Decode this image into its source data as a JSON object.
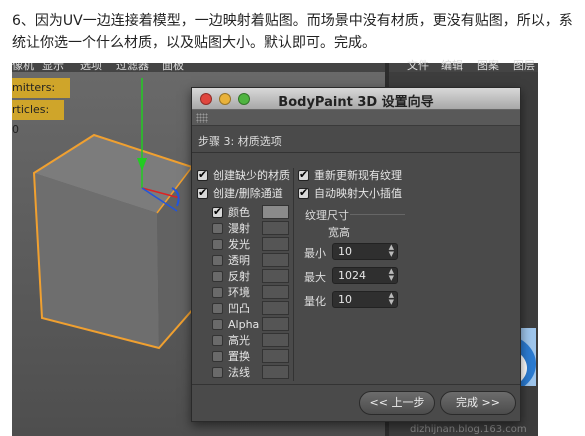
{
  "article": {
    "line1": "6、因为UV一边连接着模型，一边映射着贴图。而场景中没有材质，更没有贴图，所以，系",
    "line2": "统让你选一个什么材质，以及贴图大小。默认即可。完成。"
  },
  "viewport": {
    "menu": [
      "像机",
      "显示",
      "选项",
      "过滤器",
      "面板"
    ],
    "hud": [
      {
        "label": "mitters:",
        "value": "0"
      },
      {
        "label": "rticles:",
        "value": "0"
      }
    ]
  },
  "right_panel": {
    "menu": [
      "文件",
      "编辑",
      "图案",
      "图层"
    ]
  },
  "dialog": {
    "title": "BodyPaint 3D 设置向导",
    "step_title": "步骤 3: 材质选项",
    "left_options": [
      {
        "label": "创建缺少的材质",
        "checked": true
      },
      {
        "label": "创建/删除通道",
        "checked": true
      }
    ],
    "channels": [
      {
        "label": "颜色",
        "checked": true,
        "filled": true
      },
      {
        "label": "漫射",
        "checked": false,
        "filled": false
      },
      {
        "label": "发光",
        "checked": false,
        "filled": false
      },
      {
        "label": "透明",
        "checked": false,
        "filled": false
      },
      {
        "label": "反射",
        "checked": false,
        "filled": false
      },
      {
        "label": "环境",
        "checked": false,
        "filled": false
      },
      {
        "label": "凹凸",
        "checked": false,
        "filled": false
      },
      {
        "label": "Alpha",
        "checked": false,
        "filled": false
      },
      {
        "label": "高光",
        "checked": false,
        "filled": false
      },
      {
        "label": "置换",
        "checked": false,
        "filled": false
      },
      {
        "label": "法线",
        "checked": false,
        "filled": false
      }
    ],
    "right_options": [
      {
        "label": "重新更新现有纹理",
        "checked": true
      },
      {
        "label": "自动映射大小插值",
        "checked": true
      }
    ],
    "texture_size": {
      "group_title": "纹理尺寸",
      "width_height_label": "宽高",
      "min_label": "最小",
      "min_value": "10",
      "max_label": "最大",
      "max_value": "1024",
      "quant_label": "量化",
      "quant_value": "10"
    },
    "back_button": "<< 上一步",
    "finish_button": "完成 >>"
  },
  "watermark": "dizhijnan.blog.163.com",
  "colors": {
    "hud": "#cfa52a",
    "cube_edge": "#f0a030",
    "axis_y": "#22cc22",
    "axis_x": "#dd2222",
    "axis_z": "#2255dd"
  }
}
